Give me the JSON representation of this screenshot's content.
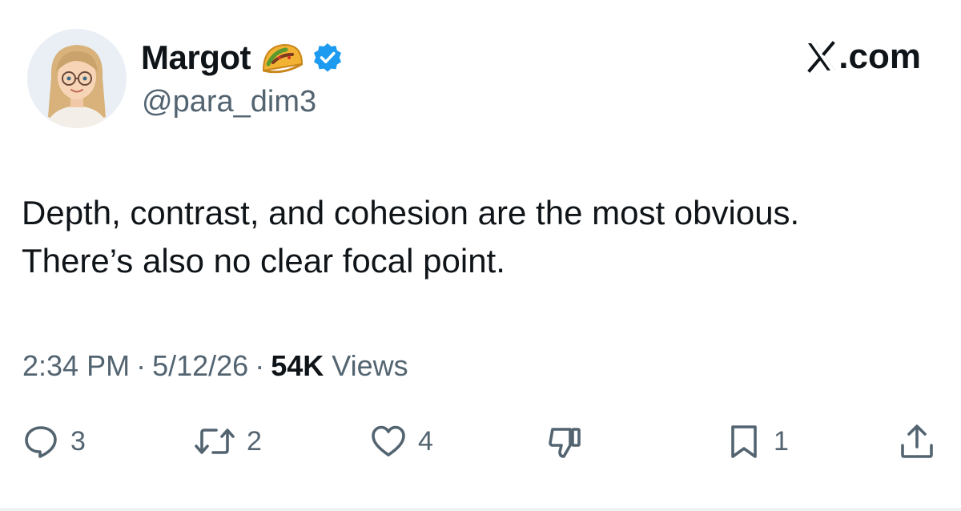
{
  "author": {
    "display_name": "Margot",
    "handle": "@para_dim3",
    "badge_emoji_icon": "taco-icon",
    "verified_icon": "verified-badge-icon",
    "verified_color": "#1d9bf0"
  },
  "source": {
    "label": ".com",
    "logo_icon": "x-logo-icon"
  },
  "tweet": {
    "lines": [
      "Depth, contrast, and cohesion are the most obvious.",
      "There’s also no clear focal point."
    ],
    "time": "2:34 PM",
    "date": "5/12/26",
    "separator": "·",
    "views_count": "54K",
    "views_label": "Views"
  },
  "actions": {
    "reply": {
      "icon": "reply-icon",
      "count": "3"
    },
    "retweet": {
      "icon": "retweet-icon",
      "count": "2"
    },
    "like": {
      "icon": "heart-icon",
      "count": "4"
    },
    "dislike": {
      "icon": "thumbs-down-icon"
    },
    "bookmark": {
      "icon": "bookmark-icon",
      "count": "1"
    },
    "share": {
      "icon": "share-icon"
    }
  },
  "colors": {
    "text": "#0f1419",
    "secondary": "#536471",
    "divider": "#eff3f4"
  }
}
